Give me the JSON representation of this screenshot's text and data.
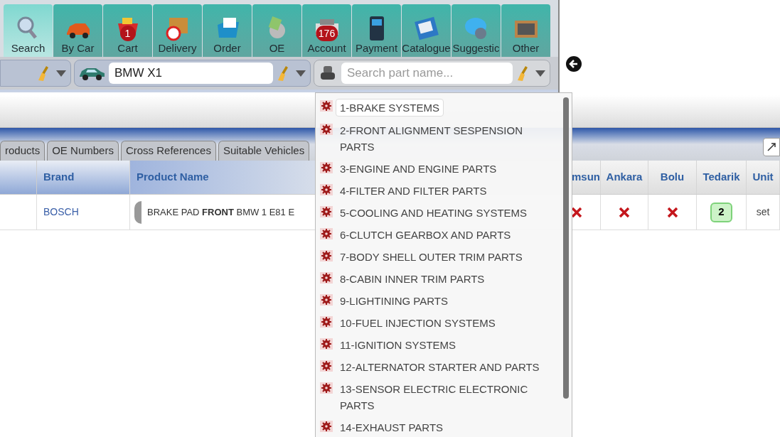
{
  "toolbar": [
    {
      "label": "Search",
      "selected": true
    },
    {
      "label": "By Car",
      "selected": false
    },
    {
      "label": "Cart",
      "selected": false,
      "badge": "1"
    },
    {
      "label": "Delivery",
      "selected": false
    },
    {
      "label": "Order",
      "selected": false
    },
    {
      "label": "OE",
      "selected": false
    },
    {
      "label": "Account",
      "selected": false,
      "badge": "176"
    },
    {
      "label": "Payment",
      "selected": false
    },
    {
      "label": "Catalogue",
      "selected": false
    },
    {
      "label": "Suggestic",
      "selected": false
    },
    {
      "label": "Other",
      "selected": false
    }
  ],
  "vehicle_field": {
    "value": "BMW X1"
  },
  "part_search": {
    "placeholder": "Search part name..."
  },
  "tabs": [
    {
      "label": "roducts",
      "selected": false
    },
    {
      "label": "OE Numbers",
      "selected": false
    },
    {
      "label": "Cross References",
      "selected": false
    },
    {
      "label": "Suitable Vehicles",
      "selected": false
    }
  ],
  "table": {
    "columns": [
      "Brand",
      "Product Name",
      "msun",
      "Ankara",
      "Bolu",
      "Tedarik",
      "Unit"
    ],
    "rows": [
      {
        "brand": "BOSCH",
        "product": "BRAKE PAD **FRONT** BMW 1 E81 E",
        "stock": [
          false,
          false,
          false
        ],
        "tedarik": "2",
        "unit": "set"
      }
    ]
  },
  "category_dropdown": {
    "items": [
      {
        "label": "1-BRAKE SYSTEMS",
        "selected": true
      },
      {
        "label": "2-FRONT ALIGNMENT SESPENSION PARTS",
        "selected": false
      },
      {
        "label": "3-ENGINE AND ENGINE PARTS",
        "selected": false
      },
      {
        "label": "4-FILTER AND FILTER PARTS",
        "selected": false
      },
      {
        "label": "5-COOLING AND HEATING SYSTEMS",
        "selected": false
      },
      {
        "label": "6-CLUTCH GEARBOX AND PARTS",
        "selected": false
      },
      {
        "label": "7-BODY SHELL OUTER TRIM PARTS",
        "selected": false
      },
      {
        "label": "8-CABIN INNER TRIM PARTS",
        "selected": false
      },
      {
        "label": "9-LIGHTINING PARTS",
        "selected": false
      },
      {
        "label": "10-FUEL INJECTION SYSTEMS",
        "selected": false
      },
      {
        "label": "11-IGNITION SYSTEMS",
        "selected": false
      },
      {
        "label": "12-ALTERNATOR STARTER AND PARTS",
        "selected": false
      },
      {
        "label": "13-SENSOR ELECTRIC ELECTRONIC PARTS",
        "selected": false
      },
      {
        "label": "14-EXHAUST PARTS",
        "selected": false
      }
    ]
  }
}
